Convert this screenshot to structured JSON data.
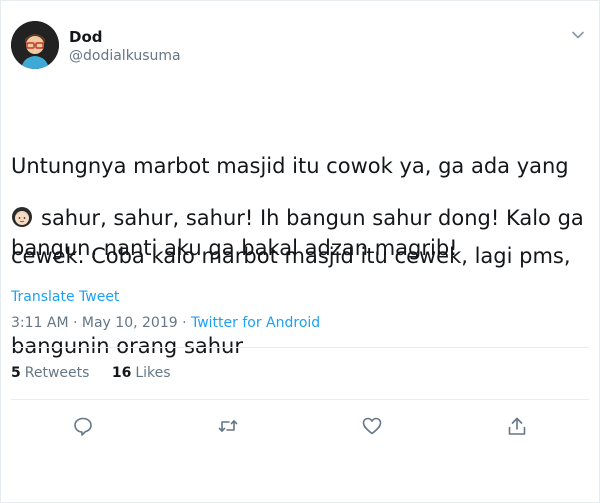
{
  "user": {
    "name": "Dod",
    "handle": "@dodialkusuma"
  },
  "tweet": {
    "lines": [
      "Untungnya marbot masjid itu cowok ya, ga ada yang",
      "cewek. Coba kalo marbot masjid itu cewek, lagi pms,",
      "bangunin orang sahur"
    ],
    "para2_lines": [
      "sahur, sahur, sahur! Ih bangun sahur dong! Kalo ga",
      "bangun, nanti aku ga bakal adzan magrib!"
    ],
    "translate_label": "Translate Tweet",
    "timestamp": "3:11 AM · May 10, 2019 · ",
    "source": "Twitter for Android"
  },
  "stats": {
    "retweets_count": "5",
    "retweets_label": "Retweets",
    "likes_count": "16",
    "likes_label": "Likes"
  },
  "icons": {
    "avatar": "avatar",
    "menu": "chevron-down-icon",
    "emoji": "woman-emoji-icon",
    "reply": "reply-icon",
    "retweet": "retweet-icon",
    "like": "heart-icon",
    "share": "share-icon"
  },
  "colors": {
    "accent": "#1da1f2",
    "text": "#14171a",
    "secondary": "#657786",
    "divider": "#e6ecf0"
  }
}
